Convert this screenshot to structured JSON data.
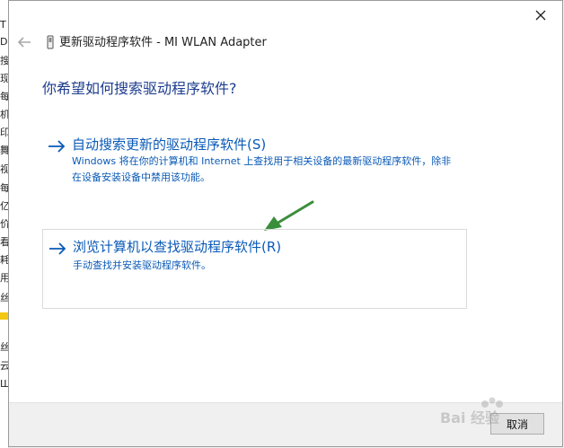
{
  "window": {
    "title": "更新驱动程序软件 - MI WLAN Adapter"
  },
  "background_window": {
    "glyphs": [
      "T",
      "DB",
      "搜",
      "现",
      "每",
      "机",
      "印",
      "舞",
      "视",
      "每",
      "亿",
      "价",
      "看",
      "耗",
      "用",
      "丝",
      "",
      "丝",
      "云",
      "Ш"
    ]
  },
  "main": {
    "question": "你希望如何搜索驱动程序软件?",
    "options": [
      {
        "label": "自动搜索更新的驱动程序软件(S)",
        "description": "Windows 将在你的计算机和 Internet 上查找用于相关设备的最新驱动程序软件，除非在设备安装设备中禁用该功能。"
      },
      {
        "label": "浏览计算机以查找驱动程序软件(R)",
        "description": "手动查找并安装驱动程序软件。"
      }
    ]
  },
  "footer": {
    "cancel_label": "取消"
  },
  "watermark": {
    "text": "Bai 经验"
  },
  "colors": {
    "link_blue": "#0a5ab7",
    "heading_blue": "#1e3d8f",
    "annotation_green": "#3a8e3a"
  },
  "icons": {
    "close": "close-icon",
    "back": "back-arrow-icon",
    "device": "usb-adapter-icon",
    "option_arrow": "arrow-right-icon"
  }
}
